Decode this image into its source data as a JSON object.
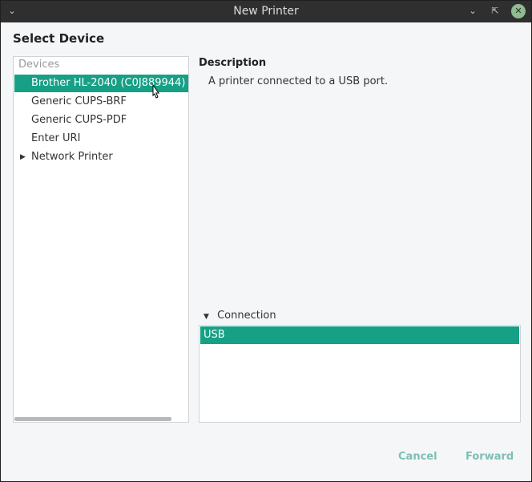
{
  "window": {
    "title": "New Printer",
    "menu_icon": "chevron-down-icon",
    "minimize_icon": "minimize-icon",
    "restore_icon": "restore-icon",
    "close_icon": "close-icon"
  },
  "heading": "Select Device",
  "devices": {
    "header": "Devices",
    "items": [
      {
        "label": "Brother HL-2040 (C0J889944)",
        "selected": true
      },
      {
        "label": "Generic CUPS-BRF",
        "selected": false
      },
      {
        "label": "Generic CUPS-PDF",
        "selected": false
      },
      {
        "label": "Enter URI",
        "selected": false
      },
      {
        "label": "Network Printer",
        "selected": false,
        "expandable": true
      }
    ]
  },
  "description": {
    "title": "Description",
    "text": "A printer connected to a USB port."
  },
  "connection": {
    "label": "Connection",
    "items": [
      {
        "label": "USB",
        "selected": true
      }
    ]
  },
  "buttons": {
    "cancel": "Cancel",
    "forward": "Forward"
  },
  "colors": {
    "accent": "#16a085",
    "titlebar": "#2f2f2f",
    "button_text": "#7fbfb3",
    "close_button": "#8fbc8f"
  }
}
